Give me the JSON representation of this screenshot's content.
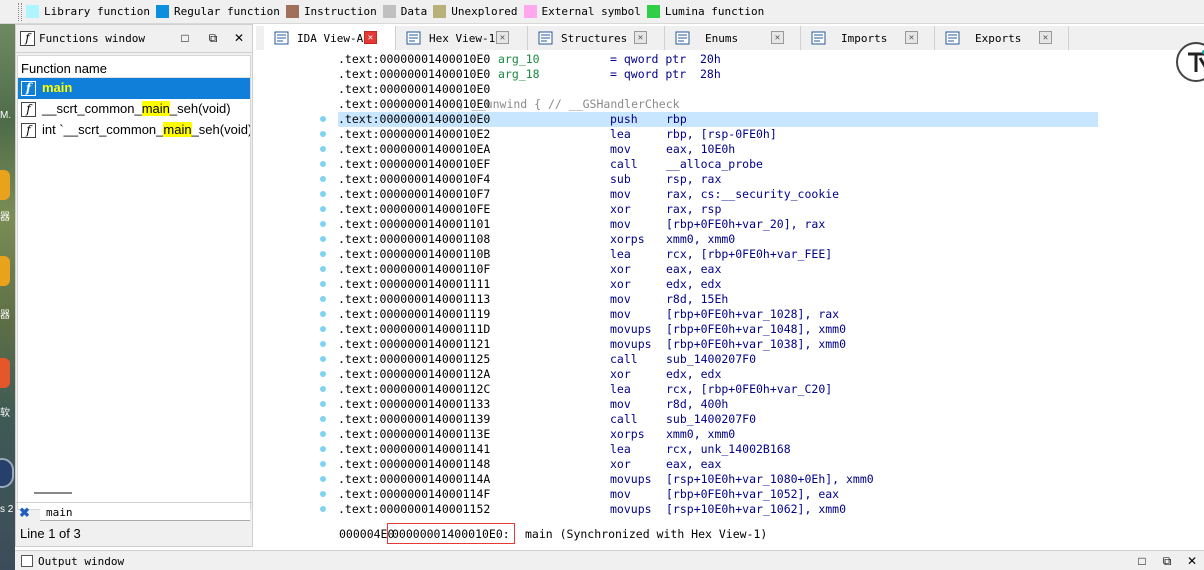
{
  "legend": [
    {
      "label": "Library function",
      "color": "#aef5ff"
    },
    {
      "label": "Regular function",
      "color": "#0d8fe0"
    },
    {
      "label": "Instruction",
      "color": "#a0705a"
    },
    {
      "label": "Data",
      "color": "#c0c0c0"
    },
    {
      "label": "Unexplored",
      "color": "#b8b27a"
    },
    {
      "label": "External symbol",
      "color": "#ffa8ee"
    },
    {
      "label": "Lumina function",
      "color": "#2ecf47"
    }
  ],
  "desktop": {
    "texts": [
      "M.",
      "器",
      "器",
      "软",
      "s 2"
    ]
  },
  "functions_window": {
    "title": "Functions window",
    "column_header": "Function name",
    "rows": [
      {
        "before": "",
        "highlight": "main",
        "after": "",
        "selected": true
      },
      {
        "before": "__scrt_common_",
        "highlight": "main",
        "after": "_seh(void)",
        "selected": false
      },
      {
        "before": "int `__scrt_common_",
        "highlight": "main",
        "after": "_seh(void)'::",
        "selected": false
      }
    ],
    "search_value": "main",
    "status": "Line 1 of 3"
  },
  "tabs": [
    {
      "label": "IDA View-A",
      "active": true,
      "icon": "ida-view-icon"
    },
    {
      "label": "Hex View-1",
      "active": false,
      "icon": "hex-view-icon"
    },
    {
      "label": "Structures",
      "active": false,
      "icon": "structures-icon"
    },
    {
      "label": "Enums",
      "active": false,
      "icon": "enums-icon"
    },
    {
      "label": "Imports",
      "active": false,
      "icon": "imports-icon"
    },
    {
      "label": "Exports",
      "active": false,
      "icon": "exports-icon"
    }
  ],
  "disassembly": [
    {
      "addr": ".text:00000001400010E0",
      "label": "arg_10",
      "mn": "= qword ptr  20h",
      "op": "",
      "type": "def"
    },
    {
      "addr": ".text:00000001400010E0",
      "label": "arg_18",
      "mn": "= qword ptr  28h",
      "op": "",
      "type": "def"
    },
    {
      "addr": ".text:00000001400010E0",
      "label": "",
      "mn": "",
      "op": "",
      "type": "blank"
    },
    {
      "addr": ".text:00000001400010E0",
      "comment": "; __unwind { // __GSHandlerCheck",
      "type": "comment"
    },
    {
      "addr": ".text:00000001400010E0",
      "mn": "push",
      "op": "rbp",
      "type": "ins",
      "current": true
    },
    {
      "addr": ".text:00000001400010E2",
      "mn": "lea",
      "op": "rbp, [rsp-0FE0h]",
      "type": "ins"
    },
    {
      "addr": ".text:00000001400010EA",
      "mn": "mov",
      "op": "eax, 10E0h",
      "type": "ins"
    },
    {
      "addr": ".text:00000001400010EF",
      "mn": "call",
      "op": "__alloca_probe",
      "type": "ins"
    },
    {
      "addr": ".text:00000001400010F4",
      "mn": "sub",
      "op": "rsp, rax",
      "type": "ins"
    },
    {
      "addr": ".text:00000001400010F7",
      "mn": "mov",
      "op": "rax, cs:__security_cookie",
      "type": "ins"
    },
    {
      "addr": ".text:00000001400010FE",
      "mn": "xor",
      "op": "rax, rsp",
      "type": "ins"
    },
    {
      "addr": ".text:0000000140001101",
      "mn": "mov",
      "op": "[rbp+0FE0h+var_20], rax",
      "type": "ins"
    },
    {
      "addr": ".text:0000000140001108",
      "mn": "xorps",
      "op": "xmm0, xmm0",
      "type": "ins"
    },
    {
      "addr": ".text:000000014000110B",
      "mn": "lea",
      "op": "rcx, [rbp+0FE0h+var_FEE]",
      "type": "ins"
    },
    {
      "addr": ".text:000000014000110F",
      "mn": "xor",
      "op": "eax, eax",
      "type": "ins"
    },
    {
      "addr": ".text:0000000140001111",
      "mn": "xor",
      "op": "edx, edx",
      "type": "ins"
    },
    {
      "addr": ".text:0000000140001113",
      "mn": "mov",
      "op": "r8d, 15Eh",
      "type": "ins"
    },
    {
      "addr": ".text:0000000140001119",
      "mn": "mov",
      "op": "[rbp+0FE0h+var_1028], rax",
      "type": "ins"
    },
    {
      "addr": ".text:000000014000111D",
      "mn": "movups",
      "op": "[rbp+0FE0h+var_1048], xmm0",
      "type": "ins"
    },
    {
      "addr": ".text:0000000140001121",
      "mn": "movups",
      "op": "[rbp+0FE0h+var_1038], xmm0",
      "type": "ins"
    },
    {
      "addr": ".text:0000000140001125",
      "mn": "call",
      "op": "sub_1400207F0",
      "type": "ins"
    },
    {
      "addr": ".text:000000014000112A",
      "mn": "xor",
      "op": "edx, edx",
      "type": "ins"
    },
    {
      "addr": ".text:000000014000112C",
      "mn": "lea",
      "op": "rcx, [rbp+0FE0h+var_C20]",
      "type": "ins"
    },
    {
      "addr": ".text:0000000140001133",
      "mn": "mov",
      "op": "r8d, 400h",
      "type": "ins"
    },
    {
      "addr": ".text:0000000140001139",
      "mn": "call",
      "op": "sub_1400207F0",
      "type": "ins"
    },
    {
      "addr": ".text:000000014000113E",
      "mn": "xorps",
      "op": "xmm0, xmm0",
      "type": "ins"
    },
    {
      "addr": ".text:0000000140001141",
      "mn": "lea",
      "op": "rcx, unk_14002B168",
      "type": "ins"
    },
    {
      "addr": ".text:0000000140001148",
      "mn": "xor",
      "op": "eax, eax",
      "type": "ins"
    },
    {
      "addr": ".text:000000014000114A",
      "mn": "movups",
      "op": "[rsp+10E0h+var_1080+0Eh], xmm0",
      "type": "ins"
    },
    {
      "addr": ".text:000000014000114F",
      "mn": "mov",
      "op": "[rbp+0FE0h+var_1052], eax",
      "type": "ins"
    },
    {
      "addr": ".text:0000000140001152",
      "mn": "movups",
      "op": "[rsp+10E0h+var_1062], xmm0",
      "type": "ins"
    }
  ],
  "status_bar": {
    "offset": "000004E0",
    "address": "00000001400010E0:",
    "info": "main (Synchronized with Hex View-1)"
  },
  "output_window": {
    "title": "Output window"
  }
}
